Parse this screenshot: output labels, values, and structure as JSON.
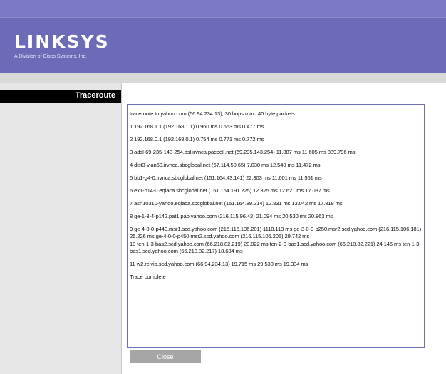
{
  "brand": {
    "logo": "LINKSYS",
    "subtitle": "A Division of Cisco Systems, Inc."
  },
  "sidebar": {
    "title": "Traceroute"
  },
  "traceroute": {
    "lines": [
      "traceroute to yahoo.com (66.94.234.13), 30 hops max, 40 byte packets",
      "1 192.168.1.1 (192.168.1.1) 0.960 ms 0.653 ms 0.477 ms",
      "2 192.168.0.1 (192.168.0.1) 0.754 ms 0.771 ms 0.772 ms",
      "3 adsl-69-235-143-254.dsl.irvnca.pacbell.net (69.235.143.254) 11.887 ms 11.605 ms 889.796 ms",
      "4 dist3-vlan60.irvnca.sbcglobal.net (67.114.50.65) 7.030 ms 12.540 ms 11.472 ms",
      "5 bb1-g4-0.irvnca.sbcglobal.net (151.164.43.141) 22.303 ms 11.601 ms 11.551 ms",
      "6 ex1-p14-0.eqlaca.sbcglobal.net (151.164.191.225) 12.325 ms 12.621 ms 17.087 ms",
      "7 asn10310-yahoo.eqlaca.sbcglobal.net (151.164.89.214) 12.831 ms 13.042 ms 17.818 ms",
      "8 ge-1-3-4-p142.pat1.pao.yahoo.com (216.115.96.42) 21.094 ms 20.530 ms 20.863 ms",
      "9 ge-4-0-0-p440.msr1.scd.yahoo.com (216.115.106.201) 1118.113 ms ge-3-0-0-p250.msr2.scd.yahoo.com (216.115.106.181) 25.226 ms ge-4-0-0-p450.msr2.scd.yahoo.com (216.115.106.205) 29.742 ms",
      "10 ten-1-3-bas2.scd.yahoo.com (66.218.82.219) 20.022 ms ten-2-3-bas1.scd.yahoo.com (66.218.82.221) 24.146 ms ten-1-3-bas1.scd.yahoo.com (66.218.82.217) 18.634 ms",
      "11 w2.rc.vip.scd.yahoo.com (66.94.234.13) 19.715 ms 29.530 ms 19.334 ms",
      "Trace complete"
    ]
  },
  "buttons": {
    "close": "Close"
  },
  "colors": {
    "header": "#6b6bb8",
    "sidebar_head": "#000000",
    "box_border": "#6f6fb3",
    "button": "#a6a6a6"
  }
}
